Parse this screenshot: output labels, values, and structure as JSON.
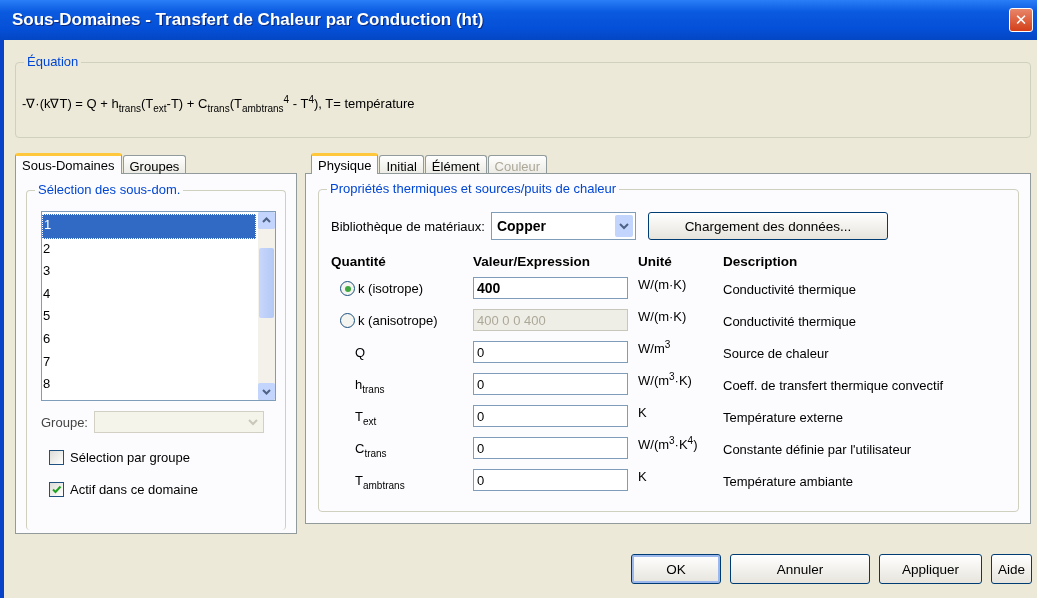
{
  "window": {
    "title": "Sous-Domaines - Transfert de Chaleur par Conduction (ht)",
    "close": "✕"
  },
  "equation": {
    "title": "Équation",
    "text": "-∇·(k∇T) = Q + h$_{trans}$(T$_{ext}$-T) + C$_{trans}$(T$_{ambtrans}$$^{4}$ - T$^{4}$), T= température"
  },
  "left_tabs": [
    {
      "label": "Sous-Domaines",
      "selected": true
    },
    {
      "label": "Groupes",
      "selected": false
    }
  ],
  "selection": {
    "title": "Sélection des sous-dom.",
    "items": [
      {
        "label": "1",
        "selected": true
      },
      {
        "label": "2",
        "selected": false
      },
      {
        "label": "3",
        "selected": false
      },
      {
        "label": "4",
        "selected": false
      },
      {
        "label": "5",
        "selected": false
      },
      {
        "label": "6",
        "selected": false
      },
      {
        "label": "7",
        "selected": false
      },
      {
        "label": "8",
        "selected": false
      }
    ],
    "group_label": "Groupe:",
    "group_disabled": true,
    "checkboxes": [
      {
        "label": "Sélection par groupe",
        "checked": false
      },
      {
        "label": "Actif dans ce domaine",
        "checked": true
      }
    ]
  },
  "right_tabs": [
    {
      "label": "Physique",
      "selected": true,
      "disabled": false
    },
    {
      "label": "Initial",
      "selected": false,
      "disabled": false
    },
    {
      "label": "Élément",
      "selected": false,
      "disabled": false
    },
    {
      "label": "Couleur",
      "selected": false,
      "disabled": true
    }
  ],
  "properties": {
    "title": "Propriétés thermiques et sources/puits de chaleur",
    "library_label": "Bibliothèque de matériaux:",
    "library_value": "Copper",
    "load_button": "Chargement des données...",
    "columns": [
      "Quantité",
      "Valeur/Expression",
      "Unité",
      "Description"
    ],
    "rows": [
      {
        "kind": "radio",
        "quantity": "k (isotrope)",
        "selected": true,
        "value": "400",
        "disabled": false,
        "unit": "W/(m·K)",
        "description": "Conductivité thermique"
      },
      {
        "kind": "radio",
        "quantity": "k (anisotrope)",
        "selected": false,
        "value": "400 0 0 400",
        "disabled": true,
        "unit": "W/(m·K)",
        "description": "Conductivité thermique"
      },
      {
        "kind": "plain",
        "quantity": "Q",
        "value": "0",
        "disabled": false,
        "unit": "W/m$^{3}$",
        "description": "Source de chaleur"
      },
      {
        "kind": "plain",
        "quantity": "h$_{trans}$",
        "value": "0",
        "disabled": false,
        "unit": "W/(m$^{3}$·K)",
        "description": "Coeff. de transfert thermique convectif"
      },
      {
        "kind": "plain",
        "quantity": "T$_{ext}$",
        "value": "0",
        "disabled": false,
        "unit": "K",
        "description": "Température externe"
      },
      {
        "kind": "plain",
        "quantity": "C$_{trans}$",
        "value": "0",
        "disabled": false,
        "unit": "W/(m$^{3}$·K$^{4}$)",
        "description": "Constante définie par l'utilisateur"
      },
      {
        "kind": "plain",
        "quantity": "T$_{ambtrans}$",
        "value": "0",
        "disabled": false,
        "unit": "K",
        "description": "Température ambiante"
      }
    ]
  },
  "buttons": [
    {
      "label": "OK",
      "default": true
    },
    {
      "label": "Annuler",
      "default": false
    },
    {
      "label": "Appliquer",
      "default": false
    },
    {
      "label": "Aide",
      "default": false
    }
  ]
}
